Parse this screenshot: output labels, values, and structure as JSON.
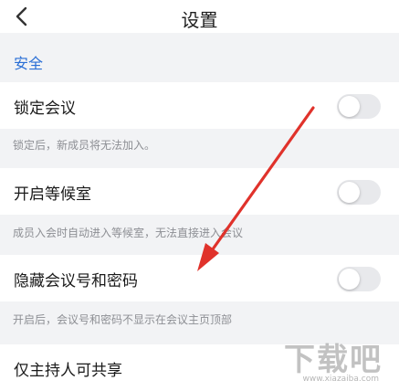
{
  "header": {
    "title": "设置",
    "back_icon": "chevron-left-icon"
  },
  "section": {
    "title": "安全"
  },
  "settings": [
    {
      "label": "锁定会议",
      "enabled": false,
      "description": "锁定后，新成员将无法加入。"
    },
    {
      "label": "开启等候室",
      "enabled": false,
      "description": "成员入会时自动进入等候室，无法直接进入会议"
    },
    {
      "label": "隐藏会议号和密码",
      "enabled": false,
      "description": "开启后，会议号和密码不显示在会议主页顶部"
    },
    {
      "label": "仅主持人可共享"
    }
  ],
  "colors": {
    "accent": "#2a6fd6",
    "annotation_arrow": "#e0322b",
    "toggle_off": "#e8e9ec"
  },
  "watermark": {
    "main": "下载吧",
    "sub": "www.xiazaiba.com"
  }
}
